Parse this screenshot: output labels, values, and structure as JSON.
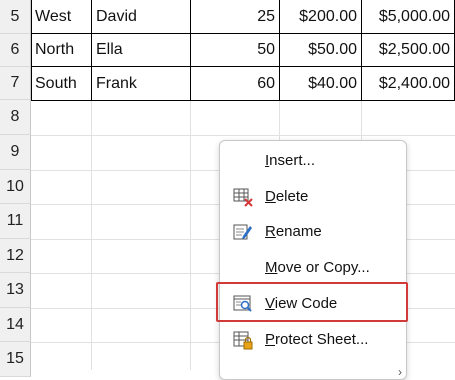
{
  "row_numbers": [
    "5",
    "6",
    "7",
    "8",
    "9",
    "10",
    "11",
    "12",
    "13",
    "14",
    "15"
  ],
  "table_rows": [
    {
      "region": "West",
      "name": "David",
      "qty": "25",
      "price": "$200.00",
      "total": "$5,000.00"
    },
    {
      "region": "North",
      "name": "Ella",
      "qty": "50",
      "price": "$50.00",
      "total": "$2,500.00"
    },
    {
      "region": "South",
      "name": "Frank",
      "qty": "60",
      "price": "$40.00",
      "total": "$2,400.00"
    }
  ],
  "context_menu": {
    "items": [
      {
        "label": "Insert...",
        "icon": "none"
      },
      {
        "label": "Delete",
        "icon": "delete-sheet-icon"
      },
      {
        "label": "Rename",
        "icon": "rename-sheet-icon"
      },
      {
        "label": "Move or Copy...",
        "icon": "none"
      },
      {
        "label": "View Code",
        "icon": "view-code-icon"
      },
      {
        "label": "Protect Sheet...",
        "icon": "protect-sheet-icon"
      }
    ]
  },
  "colors": {
    "highlight": "#d23a3a",
    "header_bg": "#f0f0f0",
    "grid": "#e1e1e1"
  }
}
